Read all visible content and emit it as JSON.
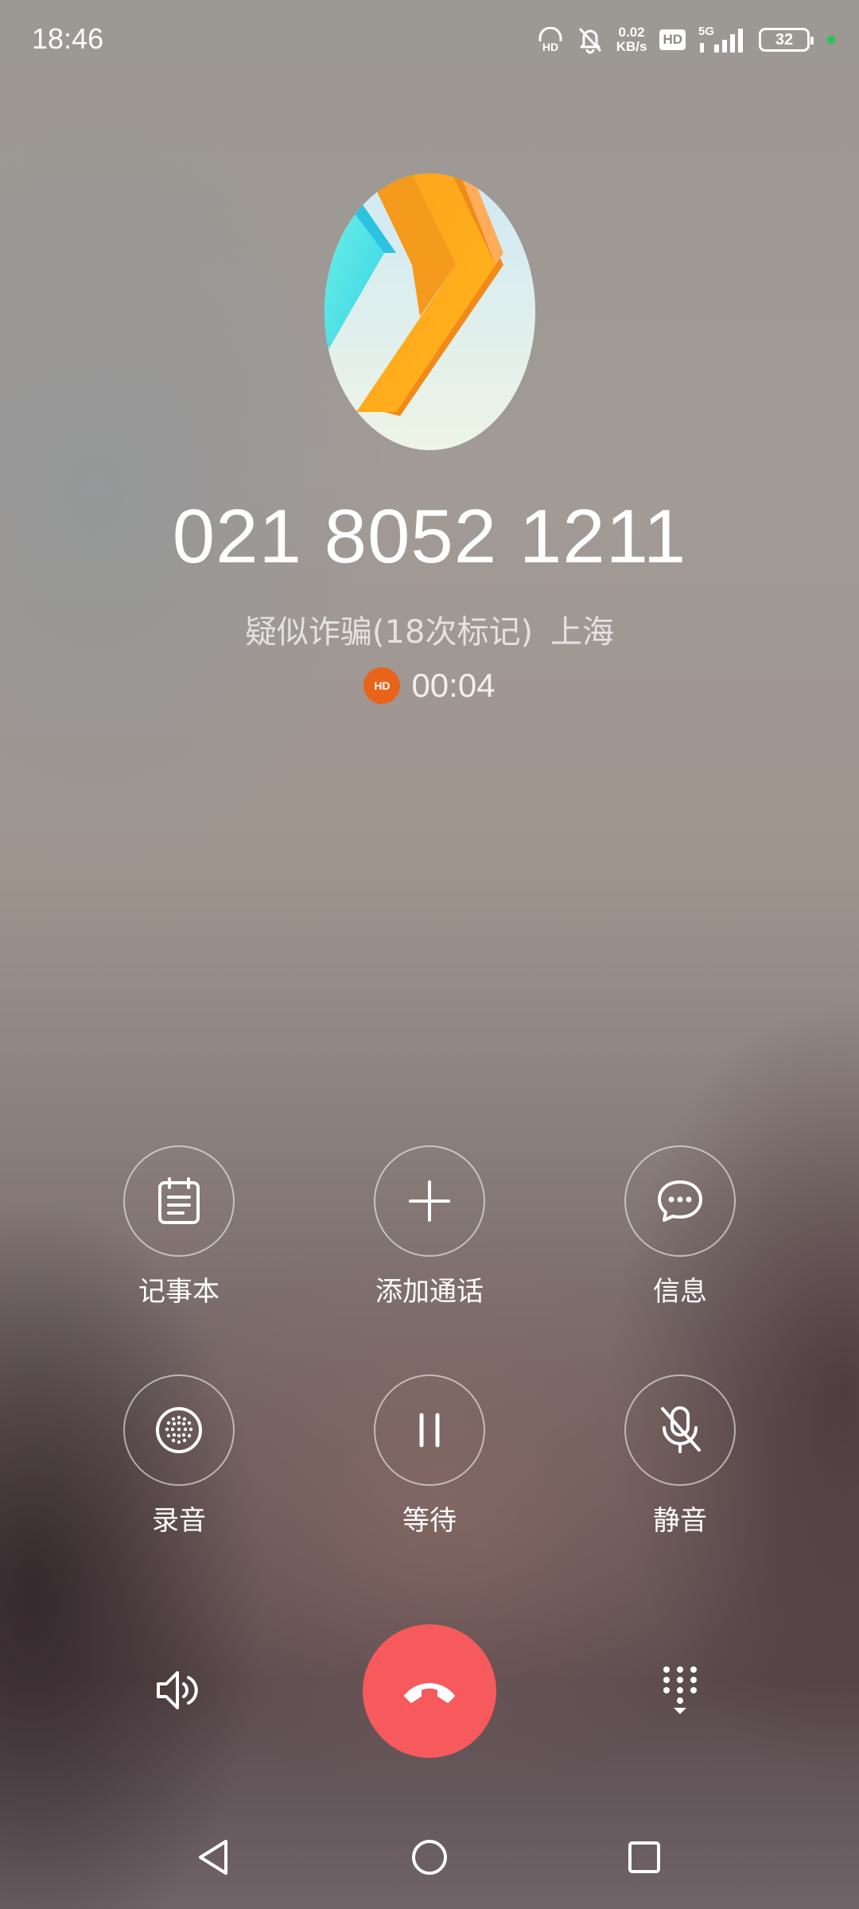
{
  "status_bar": {
    "time": "18:46",
    "net_speed_value": "0.02",
    "net_speed_unit": "KB/s",
    "hd_label": "HD",
    "network_type": "5G",
    "battery_level": "32",
    "icons": [
      "headset-hd-icon",
      "bell-off-icon",
      "hd-icon",
      "signal-icon",
      "battery-icon",
      "charging-dot-icon"
    ]
  },
  "caller": {
    "number": "021 8052 1211",
    "tag": "疑似诈骗(18次标记)",
    "location": "上海",
    "hd_badge": "HD",
    "duration": "00:04"
  },
  "controls": {
    "notepad": "记事本",
    "add_call": "添加通话",
    "message": "信息",
    "record": "录音",
    "hold": "等待",
    "mute": "静音"
  },
  "colors": {
    "hangup": "#f65a5d",
    "hd_badge": "#e8641a",
    "charging_dot": "#25c45a"
  }
}
